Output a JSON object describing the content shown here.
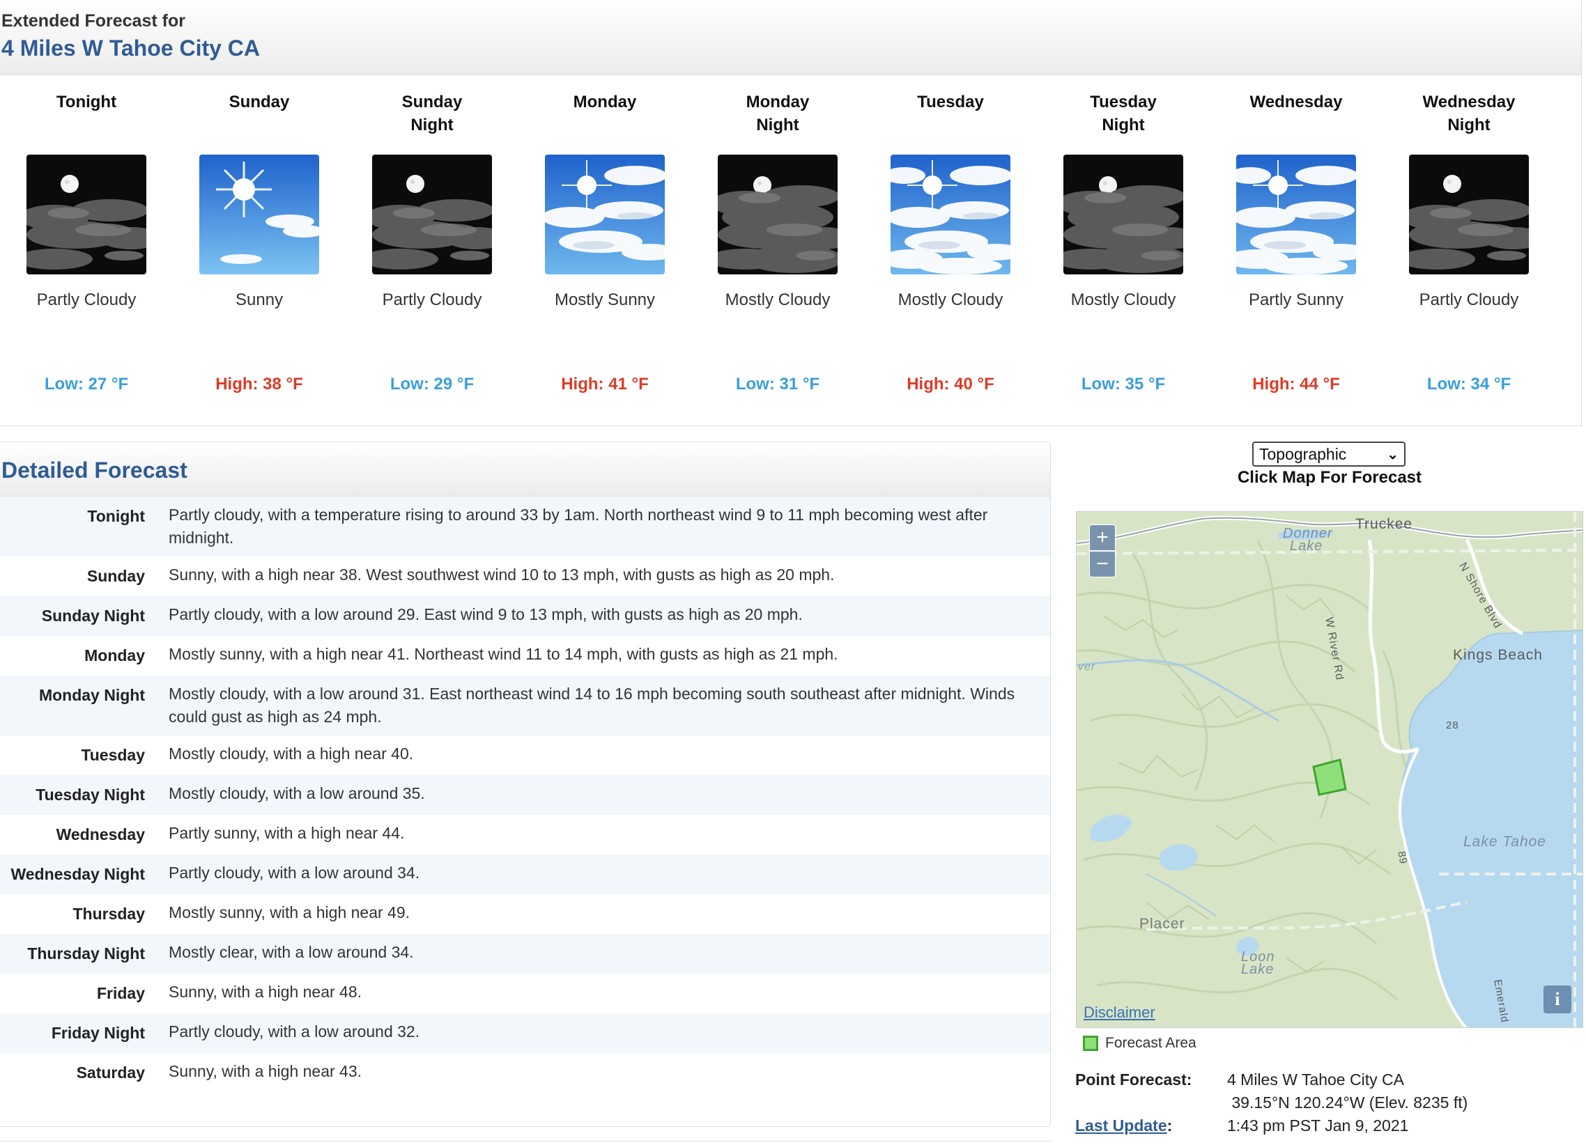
{
  "extended": {
    "heading": "Extended Forecast for",
    "location": "4 Miles W Tahoe City CA"
  },
  "periods": [
    {
      "name": "Tonight",
      "icon": "night-partly-cloudy-icon",
      "desc": "Partly Cloudy",
      "temp": "Low: 27 °F",
      "kind": "low"
    },
    {
      "name": "Sunday",
      "icon": "sunny-icon",
      "desc": "Sunny",
      "temp": "High: 38 °F",
      "kind": "high"
    },
    {
      "name": "Sunday\nNight",
      "icon": "night-partly-cloudy-icon",
      "desc": "Partly Cloudy",
      "temp": "Low: 29 °F",
      "kind": "low"
    },
    {
      "name": "Monday",
      "icon": "mostly-sunny-icon",
      "desc": "Mostly Sunny",
      "temp": "High: 41 °F",
      "kind": "high"
    },
    {
      "name": "Monday\nNight",
      "icon": "night-mostly-cloudy-icon",
      "desc": "Mostly Cloudy",
      "temp": "Low: 31 °F",
      "kind": "low"
    },
    {
      "name": "Tuesday",
      "icon": "day-mostly-cloudy-icon",
      "desc": "Mostly Cloudy",
      "temp": "High: 40 °F",
      "kind": "high"
    },
    {
      "name": "Tuesday\nNight",
      "icon": "night-mostly-cloudy-icon",
      "desc": "Mostly Cloudy",
      "temp": "Low: 35 °F",
      "kind": "low"
    },
    {
      "name": "Wednesday",
      "icon": "partly-sunny-icon",
      "desc": "Partly Sunny",
      "temp": "High: 44 °F",
      "kind": "high"
    },
    {
      "name": "Wednesday\nNight",
      "icon": "night-partly-cloudy-icon",
      "desc": "Partly Cloudy",
      "temp": "Low: 34 °F",
      "kind": "low"
    }
  ],
  "detailed": {
    "title": "Detailed Forecast",
    "rows": [
      {
        "label": "Tonight",
        "text": "Partly cloudy, with a temperature rising to around 33 by 1am. North northeast wind 9 to 11 mph becoming west after midnight."
      },
      {
        "label": "Sunday",
        "text": "Sunny, with a high near 38. West southwest wind 10 to 13 mph, with gusts as high as 20 mph."
      },
      {
        "label": "Sunday Night",
        "text": "Partly cloudy, with a low around 29. East wind 9 to 13 mph, with gusts as high as 20 mph."
      },
      {
        "label": "Monday",
        "text": "Mostly sunny, with a high near 41. Northeast wind 11 to 14 mph, with gusts as high as 21 mph."
      },
      {
        "label": "Monday Night",
        "text": "Mostly cloudy, with a low around 31. East northeast wind 14 to 16 mph becoming south southeast after midnight. Winds could gust as high as 24 mph."
      },
      {
        "label": "Tuesday",
        "text": "Mostly cloudy, with a high near 40."
      },
      {
        "label": "Tuesday Night",
        "text": "Mostly cloudy, with a low around 35."
      },
      {
        "label": "Wednesday",
        "text": "Partly sunny, with a high near 44."
      },
      {
        "label": "Wednesday Night",
        "text": "Partly cloudy, with a low around 34."
      },
      {
        "label": "Thursday",
        "text": "Mostly sunny, with a high near 49."
      },
      {
        "label": "Thursday Night",
        "text": "Mostly clear, with a low around 34."
      },
      {
        "label": "Friday",
        "text": "Sunny, with a high near 48."
      },
      {
        "label": "Friday Night",
        "text": "Partly cloudy, with a low around 32."
      },
      {
        "label": "Saturday",
        "text": "Sunny, with a high near 43."
      }
    ]
  },
  "map": {
    "select_value": "Topographic",
    "caption": "Click Map For Forecast",
    "zoom_in": "+",
    "zoom_out": "−",
    "info": "i",
    "disclaimer": "Disclaimer",
    "labels": {
      "truckee": "Truckee",
      "donner": "Donner",
      "lake": "Lake",
      "kings_beach": "Kings Beach",
      "lake_tahoe": "Lake Tahoe",
      "placer": "Placer",
      "loon": "Loon",
      "loon_lake": "Lake",
      "river_rd": "W River Rd",
      "n_shore": "N Shore Blvd",
      "emerald": "Emerald",
      "route89": "89",
      "route28": "28",
      "river": "ver"
    },
    "legend": "Forecast Area",
    "colors": {
      "terrain": "#d7e5c6",
      "water": "#b6d9f0",
      "forecast_area": "#8fe07a"
    }
  },
  "point": {
    "label": "Point Forecast:",
    "name": "4 Miles W Tahoe City CA",
    "coords": " 39.15°N 120.24°W (Elev. 8235 ft)",
    "update_label": "Last Update",
    "update_colon": ":",
    "update_value": "1:43 pm PST Jan 9, 2021"
  },
  "colors": {
    "title_blue": "#2f5c94",
    "low_blue": "#3a9fdb",
    "high_red": "#de3b26"
  }
}
